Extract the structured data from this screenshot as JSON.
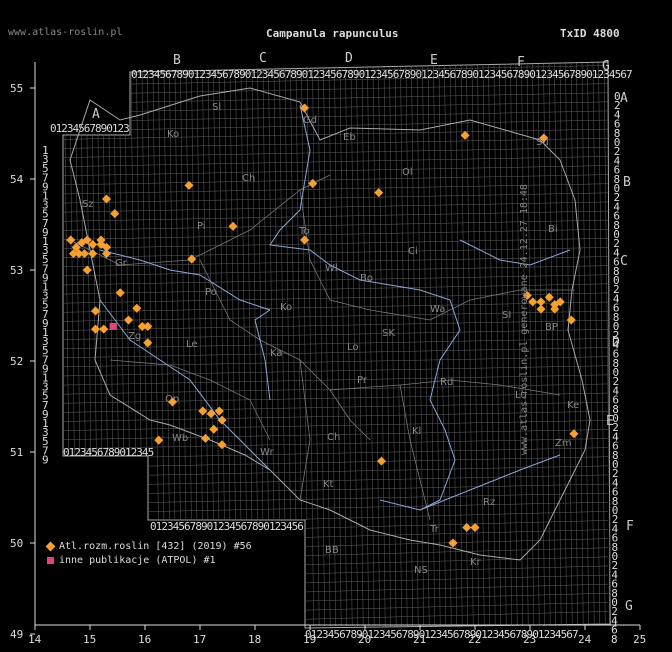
{
  "header": {
    "site": "www.atlas-roslin.pl",
    "species": "Campanula rapunculus",
    "taxon_id": "TxID 4800"
  },
  "side_caption": "www.atlas-roslin.pl generowane 24.12.27 18:48",
  "axes": {
    "x_ticks": [
      "14",
      "15",
      "16",
      "17",
      "18",
      "19",
      "20",
      "21",
      "22",
      "23",
      "24",
      "25"
    ],
    "y_ticks": [
      "55",
      "54",
      "53",
      "52",
      "51",
      "50",
      "49"
    ]
  },
  "grid_letters": {
    "columns": [
      "A",
      "B",
      "C",
      "D",
      "E",
      "F",
      "G"
    ],
    "rows": [
      "A",
      "B",
      "C",
      "D",
      "E",
      "F",
      "G"
    ]
  },
  "regions": [
    "Sl",
    "Gd",
    "Eb",
    "Ko",
    "Ol",
    "Su",
    "Sz",
    "Ch",
    "Pi",
    "To",
    "Bi",
    "Gr",
    "Ci",
    "Wl",
    "Bo",
    "Wa",
    "Po",
    "Ko",
    "SI",
    "BP",
    "Zg",
    "Le",
    "Ka",
    "Lo",
    "SK",
    "Pr",
    "Rd",
    "Lu",
    "Op",
    "Ke",
    "Wb",
    "Ch",
    "Wr",
    "Kl",
    "Zm",
    "Kt",
    "Tr",
    "Rz",
    "BB",
    "NS",
    "Kr"
  ],
  "colors": {
    "atlas": "#f5a030",
    "other": "#e8407a",
    "grid": "#606060",
    "river": "#8aa6d8",
    "border": "#aaaaaa"
  },
  "legend": [
    {
      "symbol": "orange-diamond",
      "label": "Atl.rozm.roslin [432] (2019) #56"
    },
    {
      "symbol": "pink-square",
      "label": "inne publikacje (ATPOL) #1"
    }
  ],
  "records": {
    "atlas": [
      [
        14.65,
        53.33
      ],
      [
        14.75,
        53.25
      ],
      [
        14.85,
        53.3
      ],
      [
        14.95,
        53.33
      ],
      [
        15.05,
        53.28
      ],
      [
        14.7,
        53.18
      ],
      [
        14.8,
        53.18
      ],
      [
        14.9,
        53.18
      ],
      [
        15.05,
        53.18
      ],
      [
        15.2,
        53.28
      ],
      [
        15.3,
        53.25
      ],
      [
        15.2,
        53.33
      ],
      [
        15.3,
        53.18
      ],
      [
        14.95,
        53.0
      ],
      [
        15.3,
        53.78
      ],
      [
        15.45,
        53.62
      ],
      [
        16.8,
        53.93
      ],
      [
        19.05,
        53.95
      ],
      [
        20.25,
        53.85
      ],
      [
        18.9,
        54.78
      ],
      [
        21.82,
        54.48
      ],
      [
        23.25,
        54.45
      ],
      [
        16.85,
        53.12
      ],
      [
        17.6,
        53.48
      ],
      [
        18.9,
        53.33
      ],
      [
        15.1,
        52.55
      ],
      [
        15.55,
        52.75
      ],
      [
        15.7,
        52.45
      ],
      [
        15.85,
        52.58
      ],
      [
        15.95,
        52.38
      ],
      [
        16.05,
        52.38
      ],
      [
        15.1,
        52.35
      ],
      [
        15.25,
        52.35
      ],
      [
        16.05,
        52.2
      ],
      [
        16.5,
        51.55
      ],
      [
        17.05,
        51.45
      ],
      [
        17.2,
        51.42
      ],
      [
        17.35,
        51.45
      ],
      [
        17.4,
        51.35
      ],
      [
        17.25,
        51.25
      ],
      [
        17.1,
        51.15
      ],
      [
        17.4,
        51.08
      ],
      [
        16.25,
        51.13
      ],
      [
        20.3,
        50.9
      ],
      [
        21.6,
        50.0
      ],
      [
        21.85,
        50.17
      ],
      [
        22.0,
        50.17
      ],
      [
        22.95,
        52.72
      ],
      [
        23.05,
        52.65
      ],
      [
        23.2,
        52.65
      ],
      [
        23.35,
        52.7
      ],
      [
        23.45,
        52.62
      ],
      [
        23.55,
        52.65
      ],
      [
        23.2,
        52.57
      ],
      [
        23.45,
        52.57
      ],
      [
        23.75,
        52.45
      ],
      [
        23.8,
        51.2
      ]
    ],
    "other": [
      [
        15.42,
        52.38
      ]
    ]
  }
}
